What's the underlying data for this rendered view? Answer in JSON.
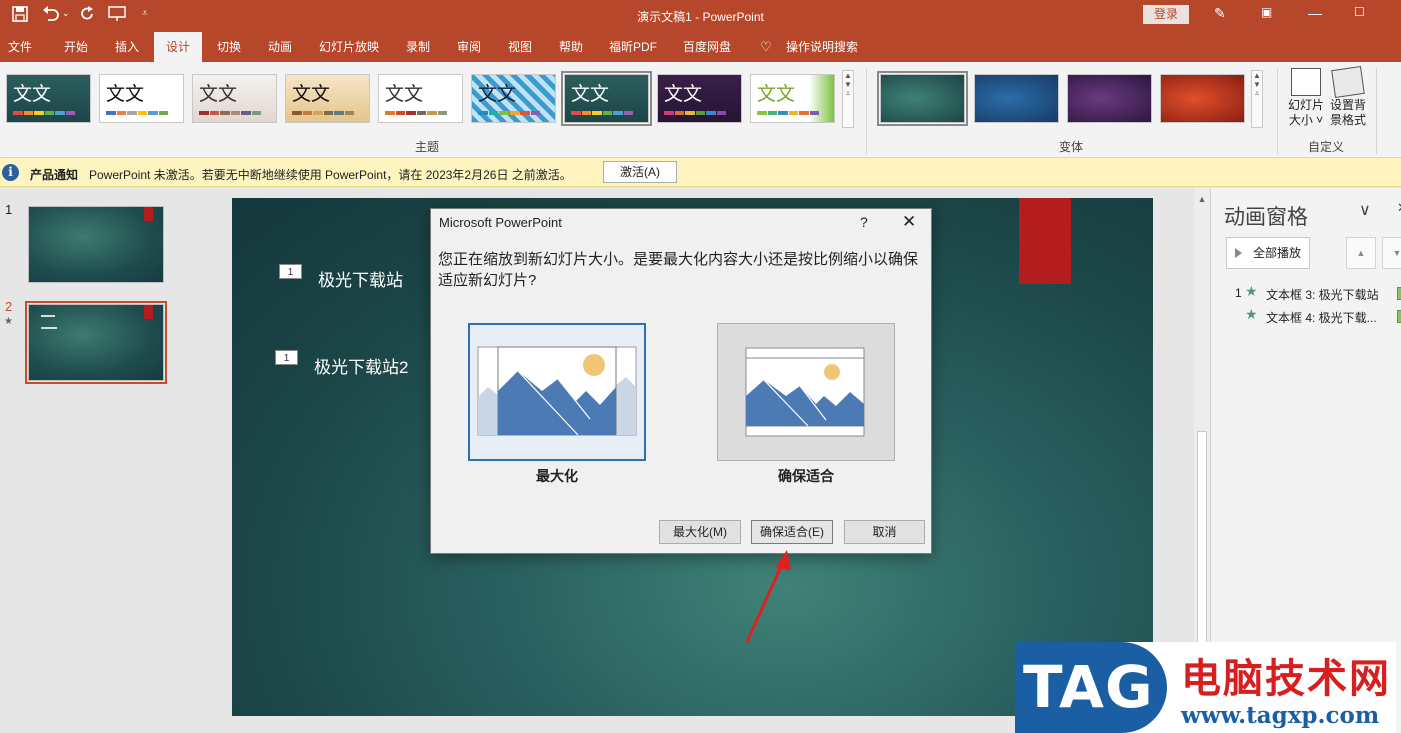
{
  "titlebar": {
    "title": "演示文稿1  -  PowerPoint",
    "login": "登录",
    "save_icon": "save-icon",
    "undo_icon": "undo-icon",
    "redo_icon": "redo-icon"
  },
  "tabs": [
    "文件",
    "开始",
    "插入",
    "设计",
    "切换",
    "动画",
    "幻灯片放映",
    "录制",
    "审阅",
    "视图",
    "帮助",
    "福昕PDF",
    "百度网盘",
    "操作说明搜索"
  ],
  "active_tab": "设计",
  "ribbon": {
    "theme_text": "文文",
    "group_themes": "主题",
    "group_variants": "变体",
    "group_customize": "自定义",
    "slide_size": [
      "幻灯片",
      "大小 ˅"
    ],
    "bg_format": [
      "设置背",
      "景格式"
    ]
  },
  "notification": {
    "label": "产品通知",
    "message": "PowerPoint 未激活。若要无中断地继续使用 PowerPoint，请在 2023年2月26日 之前激活。",
    "button": "激活(A)"
  },
  "slides": [
    {
      "number": "1"
    },
    {
      "number": "2",
      "star": "★"
    }
  ],
  "slide_content": {
    "tag1": "1",
    "text1": "极光下载站",
    "tag2": "1",
    "text2": "极光下载站2"
  },
  "animation_pane": {
    "title": "动画窗格",
    "play_all": "全部播放",
    "items": [
      {
        "num": "1",
        "label": "文本框 3: 极光下载站"
      },
      {
        "num": "",
        "label": "文本框 4: 极光下载..."
      }
    ]
  },
  "dialog": {
    "title": "Microsoft PowerPoint",
    "help": "?",
    "close": "✕",
    "message": "您正在缩放到新幻灯片大小。是要最大化内容大小还是按比例缩小以确保适应新幻灯片?",
    "option_max": "最大化",
    "option_fit": "确保适合",
    "btn_max": "最大化(M)",
    "btn_fit": "确保适合(E)",
    "btn_cancel": "取消"
  },
  "watermark": {
    "logo": "TAG",
    "name": "电脑技术网",
    "url": "www.tagxp.com"
  }
}
